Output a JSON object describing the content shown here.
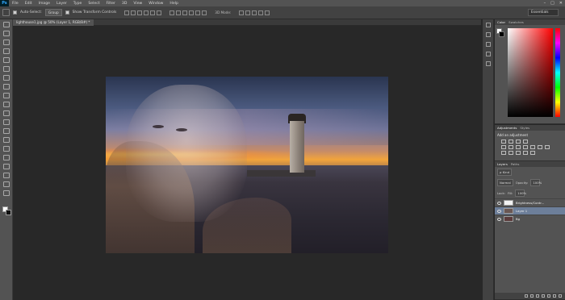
{
  "app": {
    "logo": "Ps",
    "menu": [
      "File",
      "Edit",
      "Image",
      "Layer",
      "Type",
      "Select",
      "Filter",
      "3D",
      "View",
      "Window",
      "Help"
    ],
    "window_controls": [
      "–",
      "□",
      "✕"
    ]
  },
  "options_bar": {
    "auto_select_label": "Auto-Select:",
    "auto_select_target": "Group",
    "show_transform_label": "Show Transform Controls",
    "mode_3d_label": "3D Mode:",
    "workspace": "Essentials"
  },
  "document": {
    "tab_title": "lighthouse1.jpg @ 50% (Layer 1, RGB/8#) *"
  },
  "tools": {
    "icons": [
      "move-tool-icon",
      "marquee-tool-icon",
      "lasso-tool-icon",
      "quick-select-tool-icon",
      "crop-tool-icon",
      "eyedropper-tool-icon",
      "healing-brush-icon",
      "brush-tool-icon",
      "clone-stamp-icon",
      "history-brush-icon",
      "eraser-tool-icon",
      "gradient-tool-icon",
      "blur-tool-icon",
      "dodge-tool-icon",
      "pen-tool-icon",
      "type-tool-icon",
      "path-select-icon",
      "shape-tool-icon",
      "hand-tool-icon",
      "zoom-tool-icon",
      "edit-toolbar-icon"
    ]
  },
  "panels": {
    "color": {
      "tabs": [
        "Color",
        "Swatches"
      ]
    },
    "adjustments": {
      "tabs": [
        "Adjustments",
        "Styles"
      ],
      "title": "Add an adjustment"
    },
    "layers": {
      "tabs": [
        "Layers",
        "Paths"
      ],
      "kind_filter": "ρ Kind",
      "blend_mode": "Normal",
      "opacity_label": "Opacity:",
      "opacity_value": "100%",
      "lock_label": "Lock:",
      "fill_label": "Fill:",
      "fill_value": "100%",
      "layers": [
        {
          "name": "Brightness/Contr...",
          "selected": false
        },
        {
          "name": "Layer 1",
          "selected": true
        },
        {
          "name": "Bg",
          "selected": false
        }
      ]
    }
  }
}
